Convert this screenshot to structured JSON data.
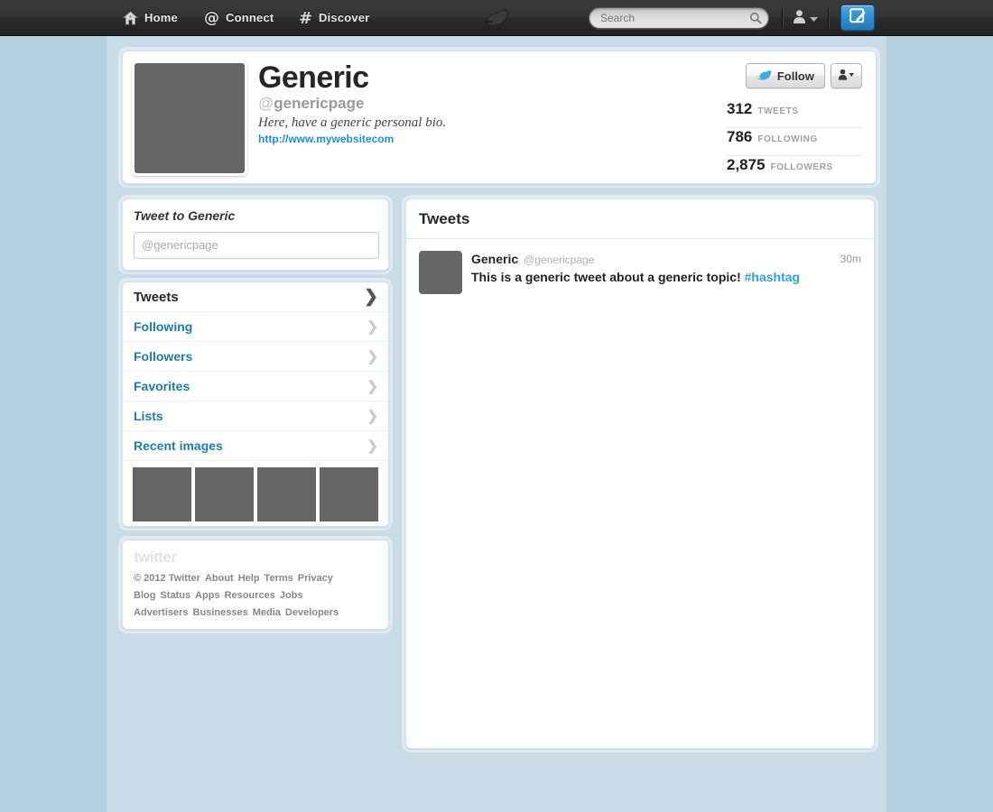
{
  "topbar": {
    "nav": [
      {
        "label": "Home",
        "icon": "home-icon"
      },
      {
        "label": "Connect",
        "icon": "at-icon"
      },
      {
        "label": "Discover",
        "icon": "hash-icon"
      }
    ],
    "logo_icon": "twitter-bird-logo",
    "search": {
      "placeholder": "Search",
      "value": "",
      "icon": "search-icon"
    },
    "account_icon": "user-avatar-icon",
    "account_caret_icon": "caret-down-icon",
    "compose_icon": "compose-tweet-icon"
  },
  "profile": {
    "name": "Generic",
    "handle_at": "@",
    "handle": "genericpage",
    "bio": "Here, have a generic personal bio.",
    "url": "http://www.mywebsitecom",
    "avatar_alt": "profile-avatar",
    "follow_label": "Follow",
    "follow_icon": "twitter-bird-icon",
    "more_icon": "person-caret-icon",
    "stats": [
      {
        "num": "312",
        "label": "TWEETS"
      },
      {
        "num": "786",
        "label": "FOLLOWING"
      },
      {
        "num": "2,875",
        "label": "FOLLOWERS"
      }
    ]
  },
  "tweetbox": {
    "title": "Tweet to Generic",
    "placeholder": "@genericpage",
    "value": ""
  },
  "sidebar_nav": [
    {
      "label": "Tweets",
      "active": true
    },
    {
      "label": "Following",
      "active": false
    },
    {
      "label": "Followers",
      "active": false
    },
    {
      "label": "Favorites",
      "active": false
    },
    {
      "label": "Lists",
      "active": false
    },
    {
      "label": "Recent images",
      "active": false
    }
  ],
  "recent_images": [
    "image-1",
    "image-2",
    "image-3",
    "image-4"
  ],
  "footer": {
    "logo_text": "twitter",
    "rows": [
      [
        "© 2012 Twitter",
        "About",
        "Help",
        "Terms",
        "Privacy"
      ],
      [
        "Blog",
        "Status",
        "Apps",
        "Resources",
        "Jobs"
      ],
      [
        "Advertisers",
        "Businesses",
        "Media",
        "Developers"
      ]
    ]
  },
  "tweets_panel": {
    "title": "Tweets",
    "items": [
      {
        "author": "Generic",
        "handle": "@genericpage",
        "time": "30m",
        "text": "This is a generic tweet about a generic topic! ",
        "hashtag": "#hashtag"
      }
    ]
  },
  "colors": {
    "page_bg": "#b3cfe0",
    "container_bg": "#c9dce8",
    "topbar_dark": "#2b2b2b",
    "link_blue": "#1a7fa8",
    "hashtag_blue": "#2aa3e0",
    "compose_blue": "#2e8fd0",
    "placeholder_gray": "#666666"
  }
}
